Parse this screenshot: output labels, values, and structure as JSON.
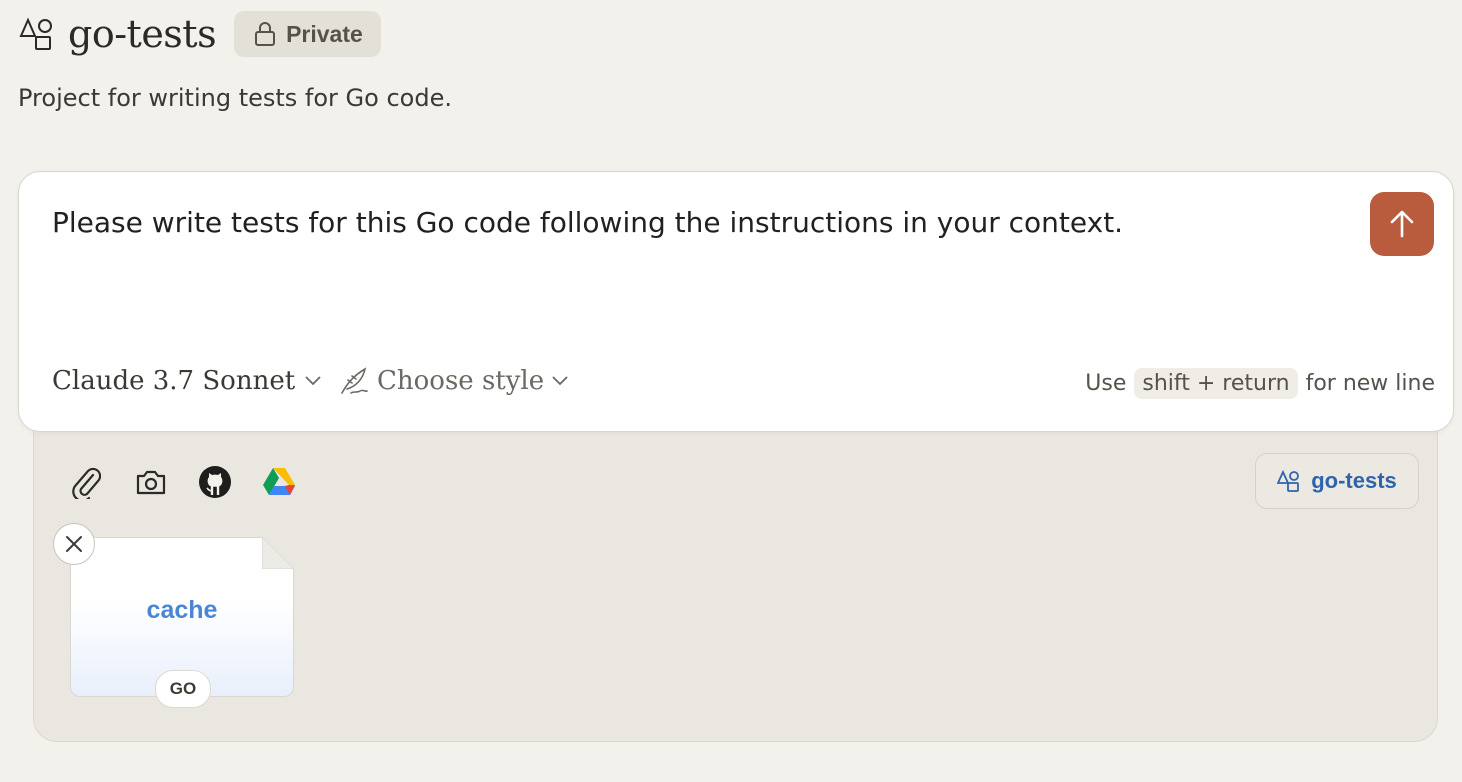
{
  "project": {
    "icon": "shapes-icon",
    "title": "go-tests",
    "visibility_label": "Private",
    "description": "Project for writing tests for Go code."
  },
  "composer": {
    "prompt_text": "Please write tests for this Go code following the instructions in your context.",
    "send_icon": "arrow-up-icon",
    "send_color": "#b85c3d",
    "model_label": "Claude 3.7 Sonnet",
    "style_label": "Choose style",
    "hint_prefix": "Use",
    "hint_key": "shift + return",
    "hint_suffix": "for new line"
  },
  "tools": [
    "paperclip-icon",
    "camera-icon",
    "github-icon",
    "google-drive-icon"
  ],
  "project_chip": {
    "label": "go-tests",
    "color": "#2f64ad"
  },
  "attachments": [
    {
      "name": "cache",
      "ext": "GO"
    }
  ]
}
